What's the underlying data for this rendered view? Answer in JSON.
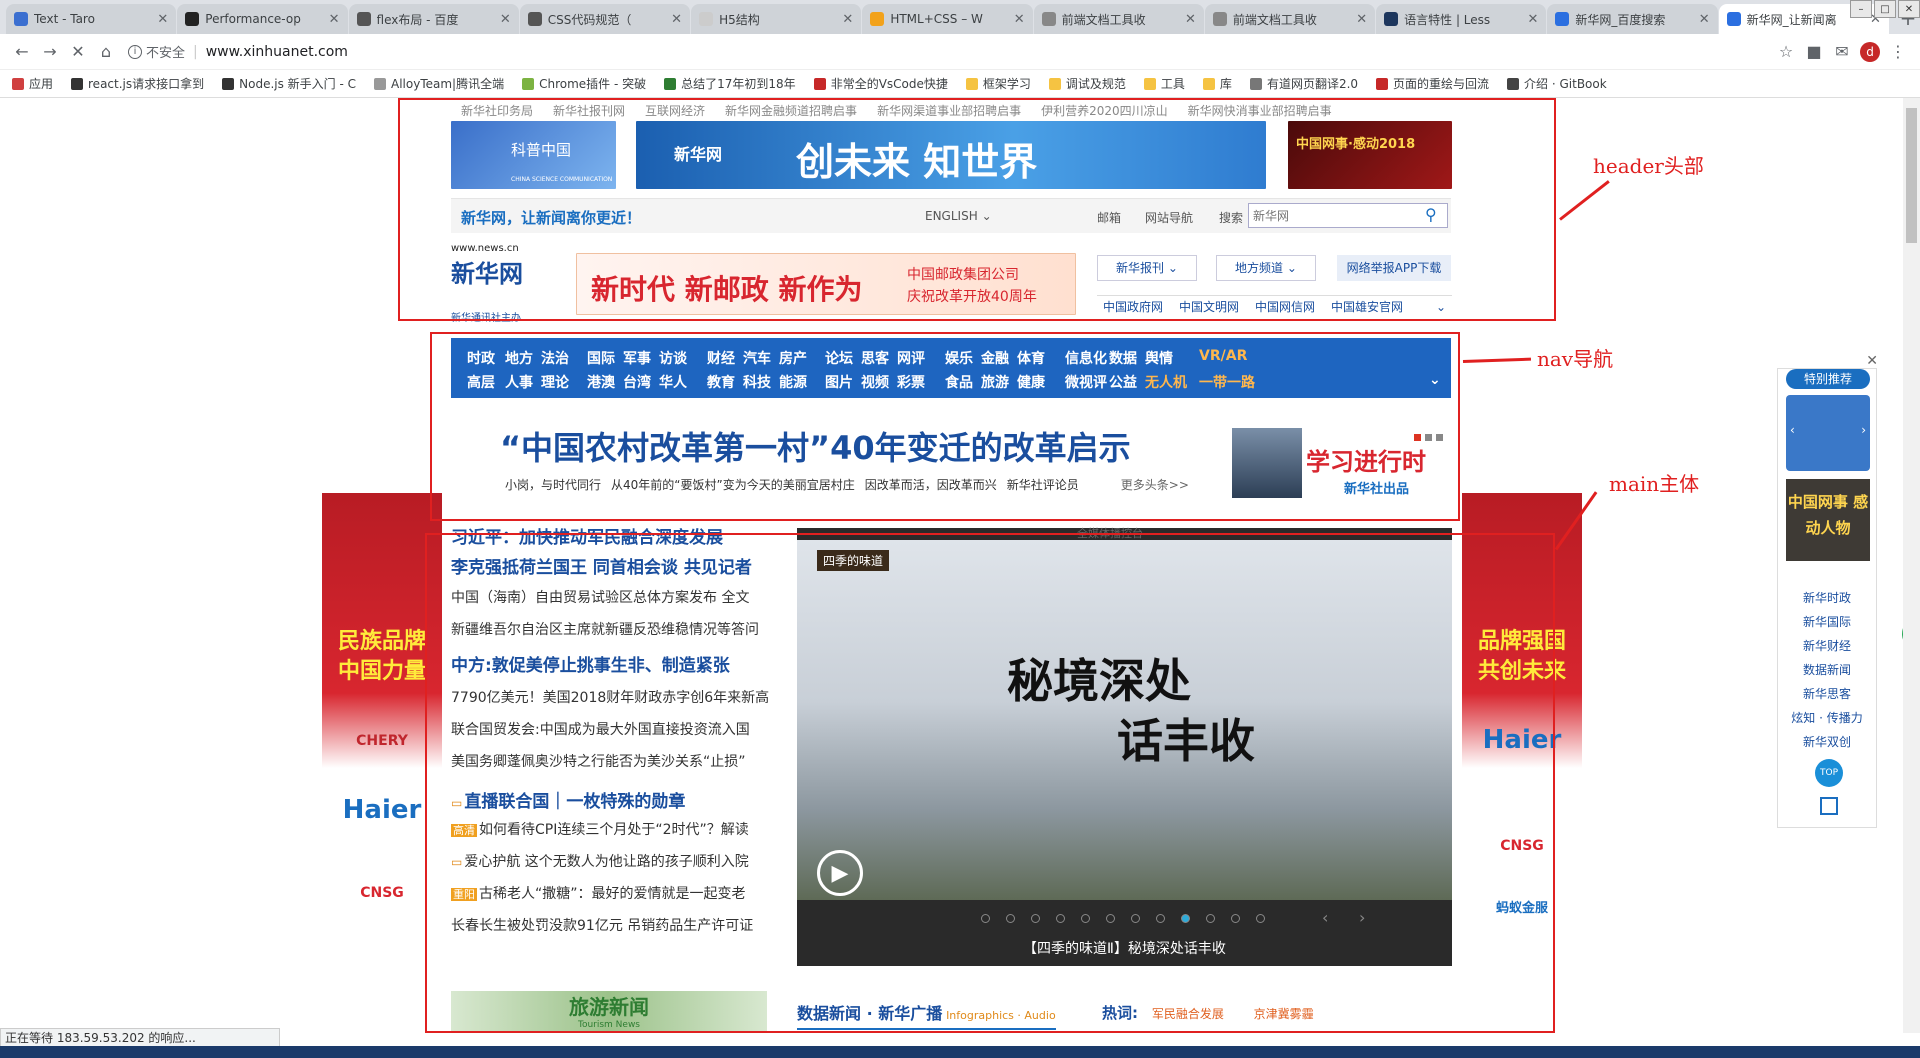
{
  "browser": {
    "tabs": [
      {
        "title": "Text - Taro",
        "active": false,
        "color": "#3b6fd0"
      },
      {
        "title": "Performance-op",
        "active": false,
        "color": "#222222"
      },
      {
        "title": "flex布局 - 百度",
        "active": false,
        "color": "#555555"
      },
      {
        "title": "CSS代码规范（",
        "active": false,
        "color": "#555555"
      },
      {
        "title": "H5结构",
        "active": false,
        "color": "#cccccc"
      },
      {
        "title": "HTML+CSS – W",
        "active": false,
        "color": "#f2a21b"
      },
      {
        "title": "前端文档工具收",
        "active": false,
        "color": "#888888"
      },
      {
        "title": "前端文档工具收",
        "active": false,
        "color": "#888888"
      },
      {
        "title": "语言特性 | Less",
        "active": false,
        "color": "#1d365d"
      },
      {
        "title": "新华网_百度搜索",
        "active": false,
        "color": "#2b6fe0"
      },
      {
        "title": "新华网_让新闻离",
        "active": true,
        "color": "#2b6fe0"
      }
    ],
    "url_security": "不安全",
    "url": "www.xinhuanet.com",
    "profile_initial": "d",
    "bookmarks": [
      {
        "label": "应用",
        "color": "#d04040"
      },
      {
        "label": "react.js请求接口拿到",
        "color": "#333333"
      },
      {
        "label": "Node.js 新手入门 - C",
        "color": "#333333"
      },
      {
        "label": "AlloyTeam|腾讯全端",
        "color": "#999999"
      },
      {
        "label": "Chrome插件 - 突破",
        "color": "#7cb342"
      },
      {
        "label": "总结了17年初到18年",
        "color": "#2e7d32"
      },
      {
        "label": "非常全的VsCode快捷",
        "color": "#c62828"
      },
      {
        "label": "框架学习",
        "color": "#f5c342"
      },
      {
        "label": "调试及规范",
        "color": "#f5c342"
      },
      {
        "label": "工具",
        "color": "#f5c342"
      },
      {
        "label": "库",
        "color": "#f5c342"
      },
      {
        "label": "有道网页翻译2.0",
        "color": "#777777"
      },
      {
        "label": "页面的重绘与回流",
        "color": "#c62828"
      },
      {
        "label": "介绍 · GitBook",
        "color": "#444444"
      }
    ],
    "status": "正在等待 183.59.53.202 的响应..."
  },
  "site": {
    "top_links": [
      "新华社印务局",
      "新华社报刊网",
      "互联网经济",
      "新华网金融频道招聘启事",
      "新华网渠道事业部招聘启事",
      "伊利营养2020四川凉山",
      "新华网快消事业部招聘启事"
    ],
    "banner_kepu": "科普中国",
    "banner_kepu_sub": "CHINA SCIENCE COMMUNICATION",
    "banner_main": "创未来 知世界",
    "banner_main_logo": "新华网",
    "banner_right": "中国网事·感动2018",
    "slogan": "新华网，让新闻离你更近！",
    "lang": "ENGLISH",
    "mail": "邮箱",
    "sitenav": "网站导航",
    "search_label": "搜索",
    "search_placeholder": "新华网",
    "logo_url": "www.news.cn",
    "logo_name": "新华网",
    "logo_sub": "新华通讯社主办",
    "postal_ad_main": "新时代 新邮政 新作为",
    "postal_ad_sub1": "中国邮政集团公司",
    "postal_ad_sub2": "庆祝改革开放40周年",
    "btn_press": "新华报刊",
    "btn_local": "地方频道",
    "btn_app": "网络举报APP下载",
    "gov_links": [
      "中国政府网",
      "中国文明网",
      "中国网信网",
      "中国雄安官网"
    ],
    "nav_row1": [
      "时政",
      "地方",
      "法治",
      "国际",
      "军事",
      "访谈",
      "财经",
      "汽车",
      "房产",
      "论坛",
      "思客",
      "网评",
      "娱乐",
      "金融",
      "体育",
      "信息化",
      "数据",
      "舆情",
      "VR/AR"
    ],
    "nav_row2": [
      "高层",
      "人事",
      "理论",
      "港澳",
      "台湾",
      "华人",
      "教育",
      "科技",
      "能源",
      "图片",
      "视频",
      "彩票",
      "食品",
      "旅游",
      "健康",
      "微视评",
      "公益",
      "无人机",
      "一带一路"
    ],
    "headline": "“中国农村改革第一村”40年变迁的改革启示",
    "headline_subs": [
      "小岗，与时代同行",
      "从40年前的“要饭村”变为今天的美丽宜居村庄",
      "因改革而活，因改革而兴",
      "新华社评论员"
    ],
    "more_headlines": "更多头条>>",
    "study_title": "学习进行时",
    "study_sub": "新华社出品",
    "news": [
      {
        "text": "习近平：加快推动军民融合深度发展",
        "style": "big"
      },
      {
        "text": "李克强抵荷兰国王 同首相会谈 共见记者",
        "style": "big"
      },
      {
        "text": "中国（海南）自由贸易试验区总体方案发布 全文",
        "style": "sm"
      },
      {
        "text": "新疆维吾尔自治区主席就新疆反恐维稳情况等答问",
        "style": "sm"
      },
      {
        "text": "中方:敦促美停止挑事生非、制造紧张",
        "style": "big"
      },
      {
        "text": "7790亿美元！美国2018财年财政赤字创6年来新高",
        "style": "sm"
      },
      {
        "text": "联合国贸发会:中国成为最大外国直接投资流入国",
        "style": "sm"
      },
      {
        "text": "美国务卿蓬佩奥沙特之行能否为美沙关系“止损”",
        "style": "sm"
      },
      {
        "text": "直播联合国｜一枚特殊的勋章",
        "style": "big"
      },
      {
        "text": "如何看待CPI连续三个月处于“2时代”？解读",
        "style": "sm",
        "tag": "高清"
      },
      {
        "text": "爱心护航 这个无数人为他让路的孩子顺利入院",
        "style": "sm"
      },
      {
        "text": "古稀老人“撒糖”：最好的爱情就是一起变老",
        "style": "sm",
        "tag": "重阳"
      },
      {
        "text": "长春长生被处罚没款91亿元 吊销药品生产许可证",
        "style": "sm"
      }
    ],
    "travel_banner": "旅游新闻",
    "travel_banner_en": "Tourism News",
    "video_caption": "【四季的味道Ⅱ】秘境深处话丰收",
    "video_tag": "四季的味道",
    "video_title1": "秘境深处",
    "video_title2": "话丰收",
    "video_header": "全媒体播控台",
    "data_news": "数据新闻 · 新华广播",
    "data_news_en": "Infographics · Audio",
    "hot_label": "热词:",
    "hot_words": [
      "军民融合发展",
      "京津冀雾霾"
    ],
    "ad_left": [
      "民族品牌",
      "中国力量"
    ],
    "ad_left_brands": [
      "CHERY",
      "Haier",
      "CNSG"
    ],
    "ad_right": [
      "品牌强国",
      "共创未来"
    ],
    "ad_right_brands": [
      "Haier",
      "CNSG",
      "蚂蚁金服"
    ],
    "right_panel_title": "特别推荐",
    "right_panel_item": "中国网事 感动人物",
    "right_panel_links": [
      "新华时政",
      "新华国际",
      "新华财经",
      "数据新闻",
      "新华思客",
      "炫知 · 传播力",
      "新华双创"
    ],
    "top_btn": "TOP"
  },
  "annotations": {
    "header": "header头部",
    "nav": "nav导航",
    "main": "main主体"
  }
}
